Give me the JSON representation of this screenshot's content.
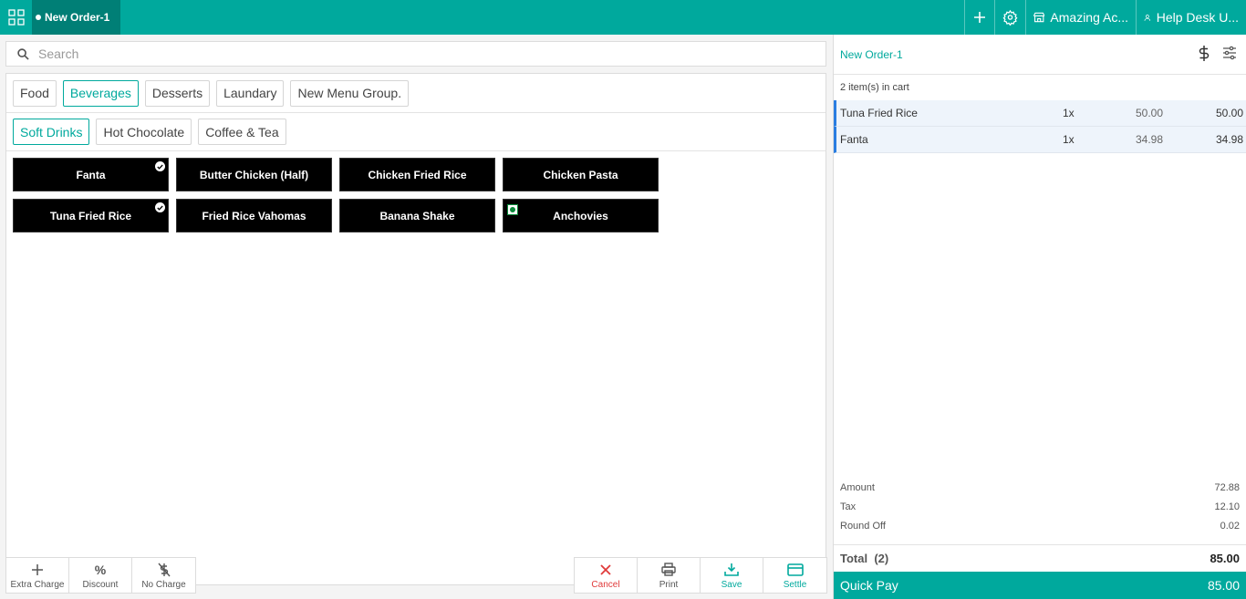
{
  "topbar": {
    "order_tab": "New Order-1",
    "add_icon": "plus-icon",
    "settings_icon": "gear-icon",
    "store_name": "Amazing Ac...",
    "user_name": "Help Desk U...",
    "color": "#00a99d"
  },
  "search": {
    "placeholder": "Search"
  },
  "menu_groups": [
    "Food",
    "Beverages",
    "Desserts",
    "Laundary",
    "New Menu Group."
  ],
  "active_group": "Beverages",
  "sub_groups": [
    "Soft Drinks",
    "Hot Chocolate",
    "Coffee & Tea"
  ],
  "active_sub_group": "Soft Drinks",
  "items": [
    {
      "name": "Fanta",
      "selected": true,
      "veg": false
    },
    {
      "name": "Butter Chicken (Half)",
      "selected": false,
      "veg": false
    },
    {
      "name": "Chicken Fried Rice",
      "selected": false,
      "veg": false
    },
    {
      "name": "Chicken Pasta",
      "selected": false,
      "veg": false
    },
    {
      "name": "Tuna Fried Rice",
      "selected": true,
      "veg": false
    },
    {
      "name": "Fried Rice Vahomas",
      "selected": false,
      "veg": false
    },
    {
      "name": "Banana Shake",
      "selected": false,
      "veg": false
    },
    {
      "name": "Anchovies",
      "selected": false,
      "veg": true
    }
  ],
  "actions_left": [
    {
      "label": "Extra Charge",
      "icon": "plus-icon"
    },
    {
      "label": "Discount",
      "icon": "percent-icon"
    },
    {
      "label": "No Charge",
      "icon": "no-dollar-icon"
    }
  ],
  "actions_right": [
    {
      "label": "Cancel",
      "icon": "close-icon"
    },
    {
      "label": "Print",
      "icon": "printer-icon"
    },
    {
      "label": "Save",
      "icon": "download-icon"
    },
    {
      "label": "Settle",
      "icon": "card-icon"
    }
  ],
  "cart": {
    "title": "New Order-1",
    "count_text": "2 item(s) in cart",
    "rows": [
      {
        "name": "Tuna Fried Rice",
        "qty": "1x",
        "price": "50.00",
        "total": "50.00"
      },
      {
        "name": "Fanta",
        "qty": "1x",
        "price": "34.98",
        "total": "34.98"
      }
    ],
    "amount_label": "Amount",
    "amount": "72.88",
    "tax_label": "Tax",
    "tax": "12.10",
    "roundoff_label": "Round Off",
    "roundoff": "0.02",
    "total_label": "Total",
    "total_count": "(2)",
    "total": "85.00",
    "quickpay_label": "Quick Pay",
    "quickpay_amount": "85.00"
  }
}
